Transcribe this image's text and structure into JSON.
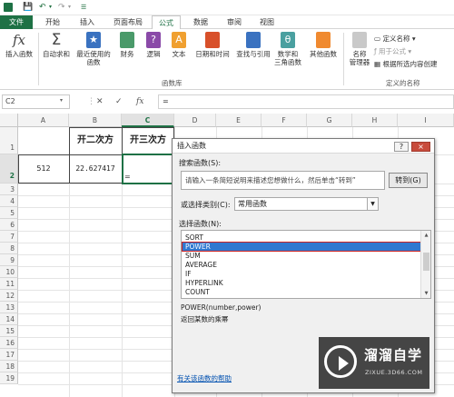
{
  "quick_access": {
    "save_icon": "save-icon",
    "undo_icon": "undo-icon",
    "redo_icon": "redo-icon"
  },
  "menu_tabs": [
    {
      "label": "文件"
    },
    {
      "label": "开始"
    },
    {
      "label": "插入"
    },
    {
      "label": "页面布局"
    },
    {
      "label": "公式"
    },
    {
      "label": "数据"
    },
    {
      "label": "审阅"
    },
    {
      "label": "视图"
    }
  ],
  "ribbon": {
    "insert_function": "插入函数",
    "autosum": "自动求和",
    "recent_line1": "最近使用的",
    "recent_line2": "函数",
    "financial": "财务",
    "logical": "逻辑",
    "text": "文本",
    "datetime": "日期和时间",
    "lookup": "查找与引用",
    "math_line1": "数学和",
    "math_line2": "三角函数",
    "other": "其他函数",
    "library_label": "函数库",
    "name_manager_line1": "名称",
    "name_manager_line2": "管理器",
    "define_name": "定义名称",
    "use_in_formula": "用于公式",
    "create_from_selection": "根据所选内容创建",
    "defined_names_label": "定义的名称"
  },
  "formula_bar": {
    "name_box": "C2",
    "content": "="
  },
  "grid": {
    "columns": [
      "A",
      "B",
      "C",
      "D",
      "E",
      "F",
      "G",
      "H",
      "I"
    ],
    "rows": [
      "1",
      "2",
      "3",
      "4",
      "5",
      "6",
      "7",
      "8",
      "9",
      "10",
      "11",
      "12",
      "13",
      "14",
      "15",
      "16",
      "17",
      "18",
      "19"
    ],
    "cells": {
      "B1": "开二次方",
      "C1": "开三次方",
      "A2": "512",
      "B2": "22.627417",
      "C2": "="
    }
  },
  "dialog": {
    "title": "插入函数",
    "search_label": "搜索函数(S):",
    "search_placeholder": "请输入一条简短说明来描述您想做什么，然后单击“转到”",
    "go_button": "转到(G)",
    "category_label": "或选择类别(C):",
    "category_value": "常用函数",
    "select_label": "选择函数(N):",
    "functions": [
      "SORT",
      "POWER",
      "SUM",
      "AVERAGE",
      "IF",
      "HYPERLINK",
      "COUNT"
    ],
    "selected_function": "POWER",
    "signature": "POWER(number,power)",
    "description": "返回某数的乘幂",
    "help_link": "有关该函数的帮助",
    "help_button": "?",
    "close_button": "×"
  },
  "watermark": {
    "title": "溜溜自学",
    "subtitle": "ZIXUE.3D66.COM"
  },
  "colors": {
    "excel_green": "#1e7145",
    "selection_blue": "#3078d0",
    "highlight_red": "#cc2222"
  }
}
